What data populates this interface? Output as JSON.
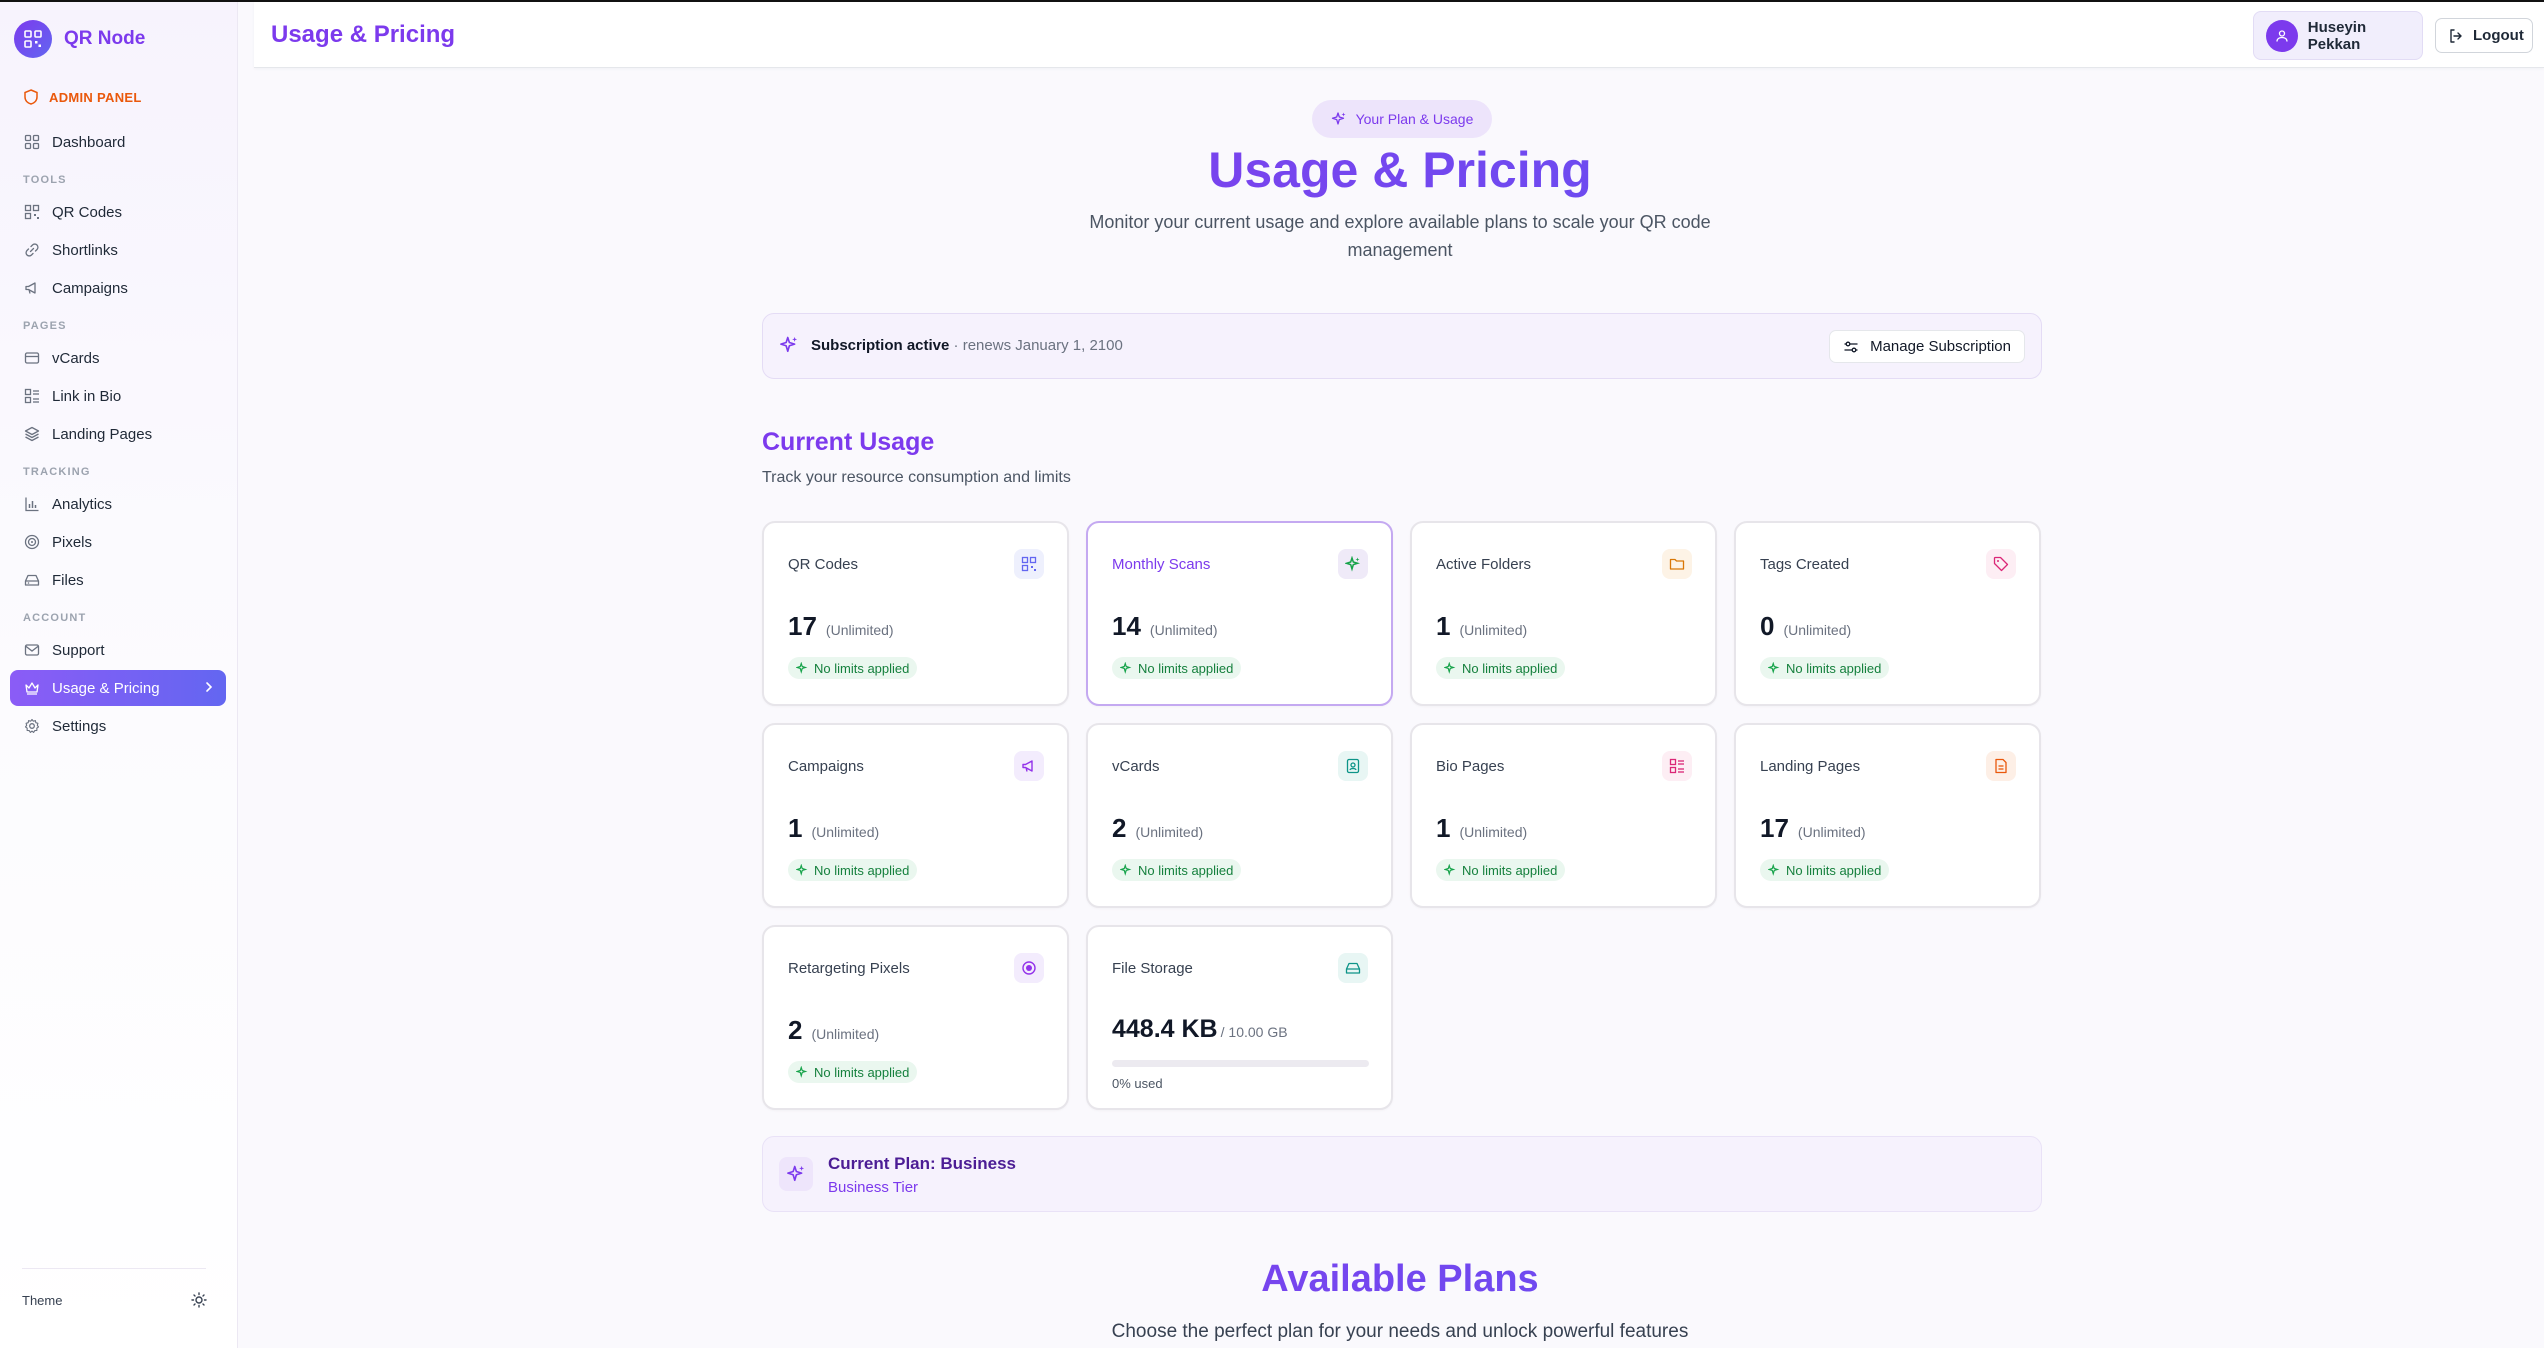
{
  "brand": {
    "name": "QR Node"
  },
  "admin": {
    "label": "ADMIN PANEL"
  },
  "nav": {
    "dashboard": "Dashboard",
    "sections": {
      "tools": "TOOLS",
      "pages": "PAGES",
      "tracking": "TRACKING",
      "account": "ACCOUNT"
    },
    "qr_codes": "QR Codes",
    "shortlinks": "Shortlinks",
    "campaigns": "Campaigns",
    "vcards": "vCards",
    "link_in_bio": "Link in Bio",
    "landing_pages": "Landing Pages",
    "analytics": "Analytics",
    "pixels": "Pixels",
    "files": "Files",
    "support": "Support",
    "usage_pricing": "Usage & Pricing",
    "settings": "Settings"
  },
  "theme": {
    "label": "Theme",
    "icon": "sun-icon"
  },
  "header": {
    "title": "Usage & Pricing",
    "user_name": "Huseyin Pekkan",
    "logout": "Logout"
  },
  "hero": {
    "badge": "Your Plan & Usage",
    "title": "Usage & Pricing",
    "subtitle": "Monitor your current usage and explore available plans to scale your QR code management"
  },
  "subscription": {
    "status": "Subscription active",
    "renew": "· renews January 1, 2100",
    "manage": "Manage Subscription"
  },
  "usage": {
    "title": "Current Usage",
    "subtitle": "Track your resource consumption and limits",
    "cards": [
      {
        "title": "QR Codes",
        "value": "17",
        "limit": "(Unlimited)",
        "note": "No limits applied",
        "icon": "qr-icon",
        "color": "#6366f1",
        "bg": "#eef0fd"
      },
      {
        "title": "Monthly Scans",
        "value": "14",
        "limit": "(Unlimited)",
        "note": "No limits applied",
        "icon": "sparkle-icon",
        "color": "#16a34a",
        "bg": "#efeaf8"
      },
      {
        "title": "Active Folders",
        "value": "1",
        "limit": "(Unlimited)",
        "note": "No limits applied",
        "icon": "folder-icon",
        "color": "#d97706",
        "bg": "#fdf3e6"
      },
      {
        "title": "Tags Created",
        "value": "0",
        "limit": "(Unlimited)",
        "note": "No limits applied",
        "icon": "tag-icon",
        "color": "#db2777",
        "bg": "#fdeef4"
      },
      {
        "title": "Campaigns",
        "value": "1",
        "limit": "(Unlimited)",
        "note": "No limits applied",
        "icon": "megaphone-icon",
        "color": "#9333ea",
        "bg": "#f3ecfd"
      },
      {
        "title": "vCards",
        "value": "2",
        "limit": "(Unlimited)",
        "note": "No limits applied",
        "icon": "contact-card-icon",
        "color": "#0d9488",
        "bg": "#e8f6f4"
      },
      {
        "title": "Bio Pages",
        "value": "1",
        "limit": "(Unlimited)",
        "note": "No limits applied",
        "icon": "bio-page-icon",
        "color": "#db2777",
        "bg": "#fdeef4"
      },
      {
        "title": "Landing Pages",
        "value": "17",
        "limit": "(Unlimited)",
        "note": "No limits applied",
        "icon": "document-icon",
        "color": "#ea580c",
        "bg": "#fdefe6"
      },
      {
        "title": "Retargeting Pixels",
        "value": "2",
        "limit": "(Unlimited)",
        "note": "No limits applied",
        "icon": "target-icon",
        "color": "#9333ea",
        "bg": "#f3ecfd"
      }
    ],
    "storage": {
      "title": "File Storage",
      "value": "448.4 KB",
      "limit": "/ 10.00 GB",
      "used_label": "0% used",
      "used_fraction": 0.0,
      "icon": "hard-drive-icon",
      "color": "#0d9488",
      "bg": "#e8f6f4"
    }
  },
  "plan": {
    "name": "Current Plan: Business",
    "tier": "Business Tier"
  },
  "available": {
    "title": "Available Plans",
    "subtitle": "Choose the perfect plan for your needs and unlock powerful features"
  }
}
